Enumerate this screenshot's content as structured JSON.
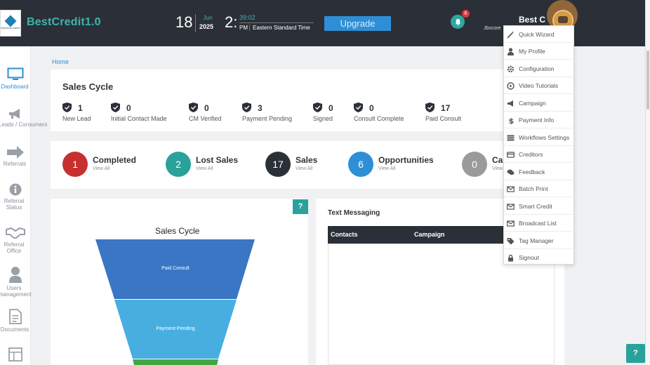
{
  "header": {
    "brand": "BestCredit1.0",
    "logo_text": "PRESTIGE CREDIT",
    "date_day": "18",
    "date_month": "Jun",
    "date_year": "2025",
    "time_hour": "2:",
    "time_minutes": "39:02",
    "time_ampm": "PM",
    "time_zone": "Eastern Standard Time",
    "upgrade_label": "Upgrade",
    "notification_count": "6",
    "user_name": "Best C",
    "user_sub": "Jbscore"
  },
  "sidebar": {
    "items": [
      {
        "label": "Dashboard",
        "icon": "monitor-icon"
      },
      {
        "label": "Leads / Consumers",
        "icon": "megaphone-icon"
      },
      {
        "label": "Referrals",
        "icon": "arrow-right-icon"
      },
      {
        "label": "Referral Status",
        "icon": "info-icon"
      },
      {
        "label": "Referral Office",
        "icon": "handshake-icon"
      },
      {
        "label": "Users management",
        "icon": "user-icon"
      },
      {
        "label": "Documents",
        "icon": "document-icon"
      },
      {
        "label": "",
        "icon": "layout-icon"
      }
    ]
  },
  "breadcrumb": "Home",
  "sales_cycle": {
    "title": "Sales Cycle",
    "stages": [
      {
        "count": "1",
        "name": "New Lead"
      },
      {
        "count": "0",
        "name": "Initial Contact Made"
      },
      {
        "count": "0",
        "name": "CM Verified"
      },
      {
        "count": "3",
        "name": "Payment Pending"
      },
      {
        "count": "0",
        "name": "Signed"
      },
      {
        "count": "0",
        "name": "Consult Complete"
      },
      {
        "count": "17",
        "name": "Paid Consult"
      }
    ]
  },
  "stats": [
    {
      "count": "1",
      "title": "Completed",
      "sub": "View All",
      "color": "#c6302e"
    },
    {
      "count": "2",
      "title": "Lost Sales",
      "sub": "View All",
      "color": "#2aa19a"
    },
    {
      "count": "17",
      "title": "Sales",
      "sub": "View All",
      "color": "#2b3038"
    },
    {
      "count": "6",
      "title": "Opportunities",
      "sub": "View All",
      "color": "#2e8fd6"
    },
    {
      "count": "0",
      "title": "Car",
      "sub": "View",
      "color": "#9a9a9a"
    }
  ],
  "funnel": {
    "help": "?",
    "title": "Sales Cycle",
    "segments": [
      {
        "label": "Paid Consult",
        "color": "#3a76c4"
      },
      {
        "label": "Payment Pending",
        "color": "#48aee0"
      },
      {
        "label": "",
        "color": "#3fa93f"
      }
    ]
  },
  "text_messaging": {
    "title": "Text Messaging",
    "columns": [
      "Contacts",
      "Campaign"
    ]
  },
  "user_menu": {
    "items": [
      {
        "label": "Quick Wizard",
        "icon": "wand-icon"
      },
      {
        "label": "My Profile",
        "icon": "user-icon"
      },
      {
        "label": "Configuration",
        "icon": "gear-icon"
      },
      {
        "label": "Video Tutorials",
        "icon": "play-circle-icon"
      },
      {
        "label": "Campaign",
        "icon": "megaphone-icon"
      },
      {
        "label": "Payment Info",
        "icon": "dollar-icon"
      },
      {
        "label": "Workflows Settings",
        "icon": "list-icon"
      },
      {
        "label": "Creditors",
        "icon": "card-icon"
      },
      {
        "label": "Feedback",
        "icon": "chat-icon"
      },
      {
        "label": "Batch Print",
        "icon": "mail-icon"
      },
      {
        "label": "Smart Credit",
        "icon": "mail-icon"
      },
      {
        "label": "Broadcast List",
        "icon": "mail-icon"
      },
      {
        "label": "Tag Manager",
        "icon": "tag-icon"
      },
      {
        "label": "Signout",
        "icon": "lock-icon"
      }
    ]
  },
  "help_float": "?"
}
